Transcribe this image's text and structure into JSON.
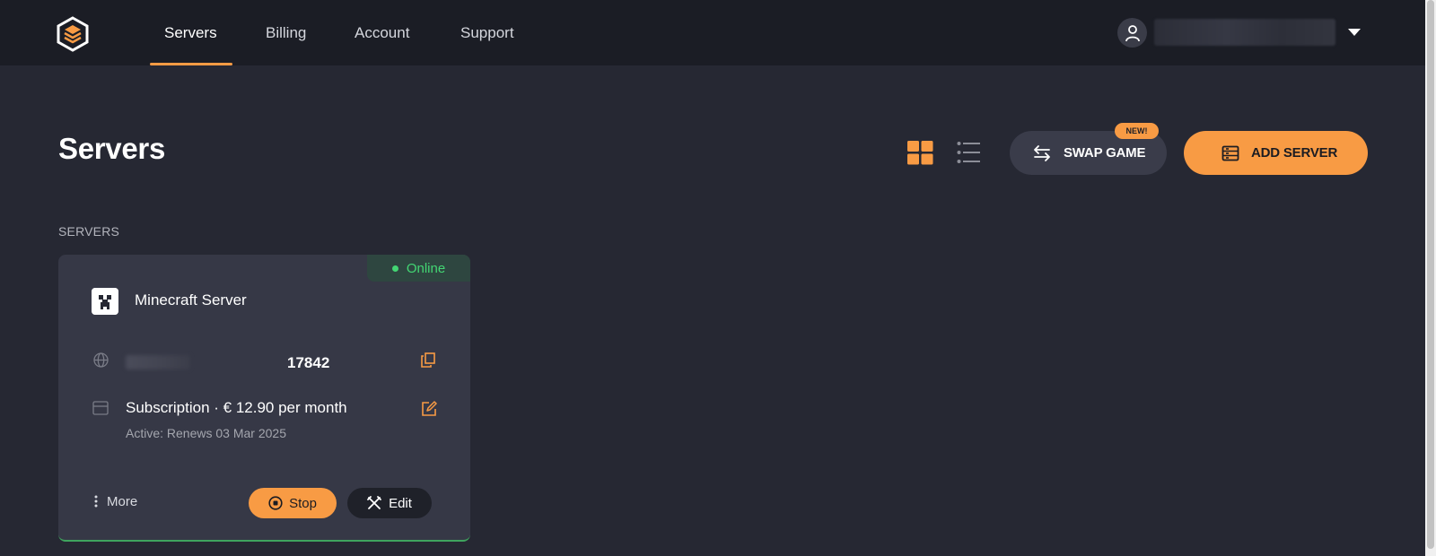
{
  "nav": {
    "items": [
      {
        "label": "Servers",
        "active": true
      },
      {
        "label": "Billing",
        "active": false
      },
      {
        "label": "Account",
        "active": false
      },
      {
        "label": "Support",
        "active": false
      }
    ]
  },
  "page": {
    "title": "Servers",
    "section_label": "SERVERS"
  },
  "toolbar": {
    "swap_label": "SWAP GAME",
    "swap_badge": "NEW!",
    "add_label": "ADD SERVER"
  },
  "server": {
    "status": "Online",
    "name": "Minecraft Server",
    "port": "17842",
    "subscription": "Subscription · € 12.90 per month",
    "renews": "Active: Renews 03 Mar 2025",
    "more_label": "More",
    "stop_label": "Stop",
    "edit_label": "Edit"
  },
  "colors": {
    "accent": "#f89b44",
    "online": "#43d673",
    "background": "#262833",
    "topbar": "#1b1d25",
    "card": "#363846"
  },
  "icons": {
    "logo": "hexagon-stack-logo",
    "user": "user-icon",
    "caret": "caret-down-icon",
    "grid_view": "grid-view-icon",
    "list_view": "list-view-icon",
    "swap": "swap-arrows-icon",
    "add_server": "server-rack-icon",
    "game": "minecraft-creeper-icon",
    "address": "globe-icon",
    "copy": "copy-icon",
    "billing": "credit-card-icon",
    "edit_sub": "edit-square-icon",
    "more": "kebab-icon",
    "stop": "stop-circle-icon",
    "edit": "tools-icon"
  }
}
